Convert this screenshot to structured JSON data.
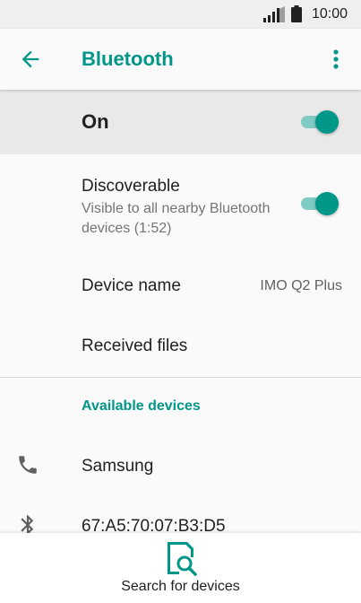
{
  "status_bar": {
    "time": "10:00",
    "signal_icon": "signal-icon",
    "battery_icon": "battery-icon"
  },
  "app_bar": {
    "title": "Bluetooth",
    "back_icon": "arrow-back-icon",
    "menu_icon": "more-vert-icon"
  },
  "master_switch": {
    "label": "On",
    "checked": true
  },
  "settings": {
    "discoverable": {
      "title": "Discoverable",
      "summary": "Visible to all nearby Bluetooth devices (1:52)",
      "checked": true
    },
    "device_name": {
      "title": "Device name",
      "value": "IMO Q2 Plus"
    },
    "received_files": {
      "title": "Received files"
    }
  },
  "available_devices": {
    "header": "Available devices",
    "items": [
      {
        "name": "Samsung",
        "icon": "phone-icon"
      },
      {
        "name": "67:A5:70:07:B3:D5",
        "icon": "bluetooth-icon"
      }
    ]
  },
  "bottom_bar": {
    "label": "Search for devices",
    "icon": "search-devices-icon"
  },
  "colors": {
    "accent": "#009688",
    "accent_light": "#80cbc4",
    "text_primary": "#212121",
    "text_secondary": "#757575",
    "master_row_bg": "#e9e9e9",
    "background": "#fafafa"
  }
}
